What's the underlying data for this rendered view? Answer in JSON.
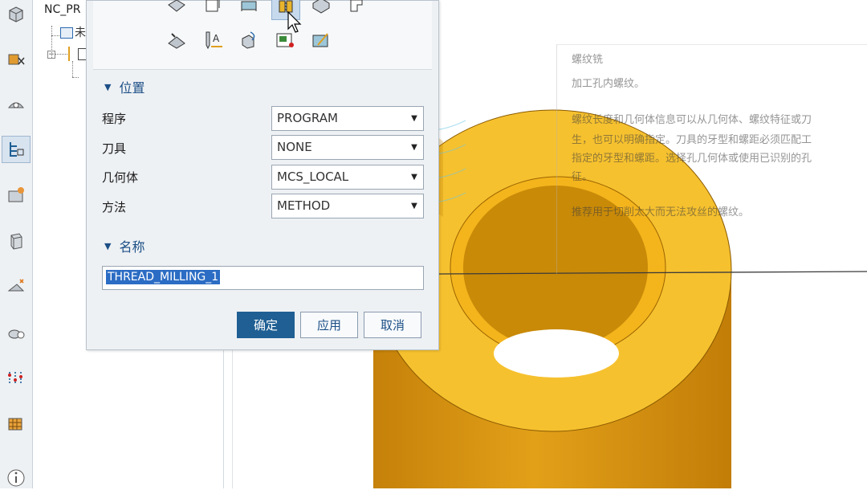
{
  "navigator": {
    "title": "NC_PR",
    "node_1_label": "未",
    "node_2_label": ""
  },
  "dialog": {
    "position_section": {
      "title": "位置",
      "rows": [
        {
          "label": "程序",
          "value": "PROGRAM"
        },
        {
          "label": "刀具",
          "value": "NONE"
        },
        {
          "label": "几何体",
          "value": "MCS_LOCAL"
        },
        {
          "label": "方法",
          "value": "METHOD"
        }
      ]
    },
    "name_section": {
      "title": "名称",
      "name_value": "THREAD_MILLING_1"
    },
    "buttons": {
      "ok": "确定",
      "apply": "应用",
      "cancel": "取消"
    }
  },
  "tooltip": {
    "title": "螺纹铣",
    "lines": [
      "加工孔内螺纹。",
      "螺纹长度和几何体信息可以从几何体、螺纹特征或刀",
      "生，也可以明确指定。刀具的牙型和螺距必须匹配工",
      "指定的牙型和螺距。选择孔几何体或使用已识别的孔",
      "征。",
      "推荐用于切削太大而无法攻丝的螺纹。"
    ]
  },
  "colors": {
    "part_top": "#f7c130",
    "part_side": "#d99310",
    "accent": "#1f5f93",
    "selection": "#2b6cc4"
  },
  "icons": {
    "left_toolbar": [
      "part-icon",
      "geometry-icon",
      "mill-icon",
      "operation-navigator-icon",
      "machine-icon",
      "cube-icon",
      "drill-icon",
      "tool-icon",
      "sequence-icon",
      "cutting-icon",
      "info-icon"
    ],
    "operation_types": [
      "cavity-mill-icon",
      "plunge-mill-icon",
      "face-mill-icon",
      "thread-mill-icon",
      "contour-icon",
      "step-icon",
      "chamfer-mill-icon",
      "engrave-text-icon",
      "probe-icon",
      "inspect-icon",
      "mill-user-icon"
    ]
  }
}
